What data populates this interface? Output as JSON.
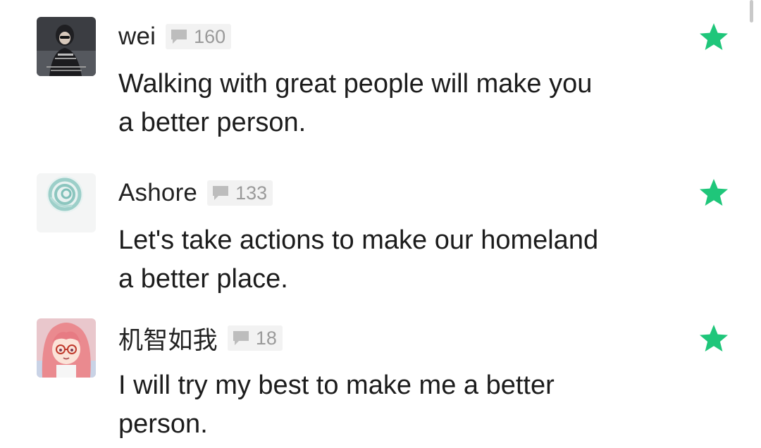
{
  "comments": [
    {
      "username": "wei",
      "reply_count": "160",
      "text_line1": "Walking with great people will make you",
      "text_line2": "a better person.",
      "avatar": "photo-portrait-dark",
      "badge_icon": "comment-bubble-icon",
      "action_icon": "star-icon"
    },
    {
      "username": "Ashore",
      "reply_count": "133",
      "text_line1": "Let's take actions to make our homeland",
      "text_line2": "a better place.",
      "avatar": "teal-spiral-circle",
      "badge_icon": "comment-bubble-icon",
      "action_icon": "star-icon"
    },
    {
      "username": "机智如我",
      "reply_count": "18",
      "text_line1": "I will try my best to make me a better",
      "text_line2": "person.",
      "avatar": "anime-girl-pink-hair-glasses",
      "badge_icon": "comment-bubble-icon",
      "action_icon": "star-icon"
    }
  ],
  "colors": {
    "star": "#1fc67a",
    "badge_bg": "#f2f2f2",
    "badge_text": "#9a9a9a",
    "text": "#1c1c1c"
  }
}
